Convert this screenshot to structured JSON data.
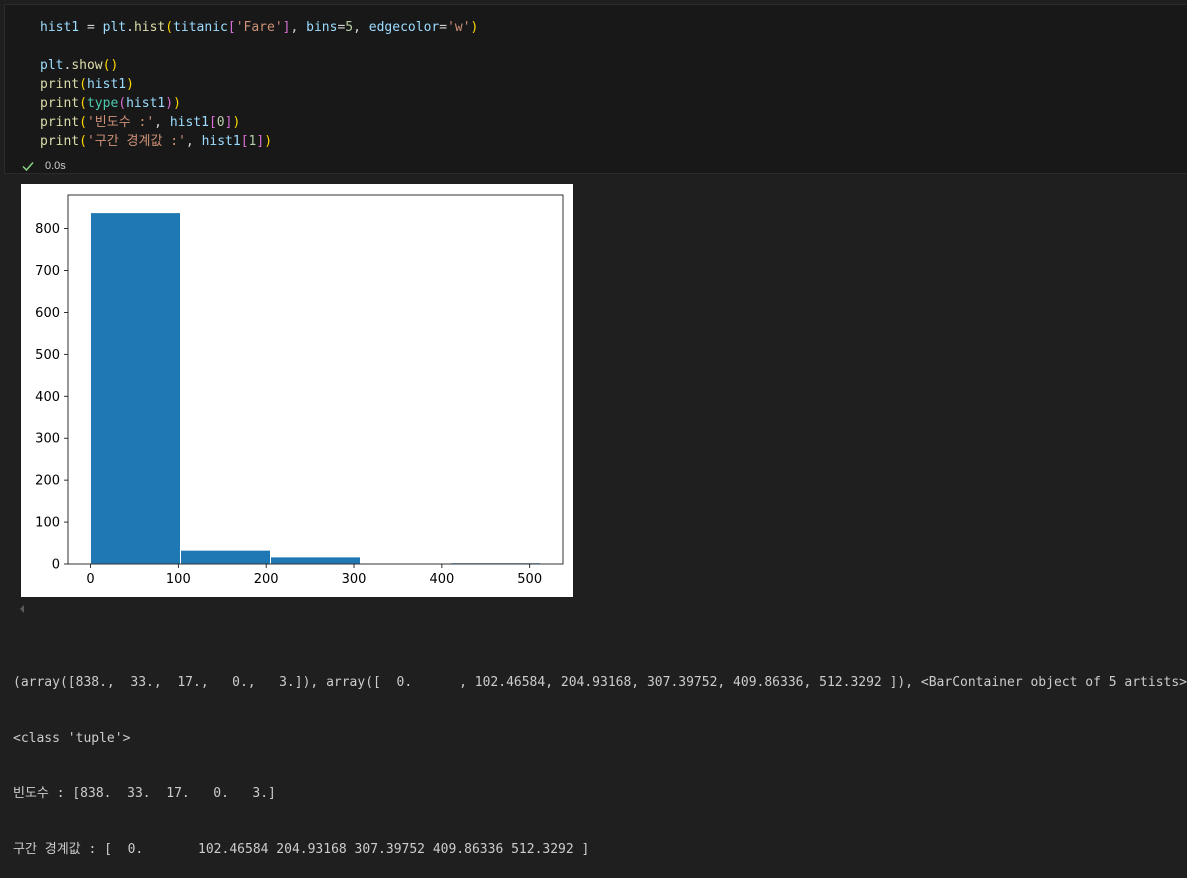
{
  "code_cell": {
    "lines": [
      [
        {
          "t": "hist1",
          "c": "tk-var"
        },
        {
          "t": " = ",
          "c": "tk-op"
        },
        {
          "t": "plt",
          "c": "tk-var"
        },
        {
          "t": ".",
          "c": "tk-op"
        },
        {
          "t": "hist",
          "c": "tk-fn"
        },
        {
          "t": "(",
          "c": "tk-b1"
        },
        {
          "t": "titanic",
          "c": "tk-var"
        },
        {
          "t": "[",
          "c": "tk-b2"
        },
        {
          "t": "'Fare'",
          "c": "tk-str"
        },
        {
          "t": "]",
          "c": "tk-b2"
        },
        {
          "t": ", ",
          "c": "tk-op"
        },
        {
          "t": "bins",
          "c": "tk-var"
        },
        {
          "t": "=",
          "c": "tk-op"
        },
        {
          "t": "5",
          "c": "tk-num"
        },
        {
          "t": ", ",
          "c": "tk-op"
        },
        {
          "t": "edgecolor",
          "c": "tk-var"
        },
        {
          "t": "=",
          "c": "tk-op"
        },
        {
          "t": "'w'",
          "c": "tk-str"
        },
        {
          "t": ")",
          "c": "tk-b1"
        }
      ],
      [],
      [
        {
          "t": "plt",
          "c": "tk-var"
        },
        {
          "t": ".",
          "c": "tk-op"
        },
        {
          "t": "show",
          "c": "tk-fn"
        },
        {
          "t": "()",
          "c": "tk-b1"
        }
      ],
      [
        {
          "t": "print",
          "c": "tk-fn"
        },
        {
          "t": "(",
          "c": "tk-b1"
        },
        {
          "t": "hist1",
          "c": "tk-var"
        },
        {
          "t": ")",
          "c": "tk-b1"
        }
      ],
      [
        {
          "t": "print",
          "c": "tk-fn"
        },
        {
          "t": "(",
          "c": "tk-b1"
        },
        {
          "t": "type",
          "c": "tk-cls"
        },
        {
          "t": "(",
          "c": "tk-b2"
        },
        {
          "t": "hist1",
          "c": "tk-var"
        },
        {
          "t": ")",
          "c": "tk-b2"
        },
        {
          "t": ")",
          "c": "tk-b1"
        }
      ],
      [
        {
          "t": "print",
          "c": "tk-fn"
        },
        {
          "t": "(",
          "c": "tk-b1"
        },
        {
          "t": "'빈도수 :'",
          "c": "tk-str"
        },
        {
          "t": ", ",
          "c": "tk-op"
        },
        {
          "t": "hist1",
          "c": "tk-var"
        },
        {
          "t": "[",
          "c": "tk-b2"
        },
        {
          "t": "0",
          "c": "tk-num"
        },
        {
          "t": "]",
          "c": "tk-b2"
        },
        {
          "t": ")",
          "c": "tk-b1"
        }
      ],
      [
        {
          "t": "print",
          "c": "tk-fn"
        },
        {
          "t": "(",
          "c": "tk-b1"
        },
        {
          "t": "'구간 경계값 :'",
          "c": "tk-str"
        },
        {
          "t": ", ",
          "c": "tk-op"
        },
        {
          "t": "hist1",
          "c": "tk-var"
        },
        {
          "t": "[",
          "c": "tk-b2"
        },
        {
          "t": "1",
          "c": "tk-num"
        },
        {
          "t": "]",
          "c": "tk-b2"
        },
        {
          "t": ")",
          "c": "tk-b1"
        }
      ]
    ]
  },
  "exec_status": {
    "icon": "check-icon",
    "time": "0.0s",
    "color": "#89d185"
  },
  "chart_data": {
    "type": "bar",
    "subtype": "histogram",
    "bin_edges": [
      0,
      102.46584,
      204.93168,
      307.39752,
      409.86336,
      512.3292
    ],
    "values": [
      838,
      33,
      17,
      0,
      3
    ],
    "xticks": [
      0,
      100,
      200,
      300,
      400,
      500
    ],
    "yticks": [
      0,
      100,
      200,
      300,
      400,
      500,
      600,
      700,
      800
    ],
    "xlim": [
      -25.6,
      537.9
    ],
    "ylim": [
      0,
      880
    ],
    "bar_color": "#1f77b4",
    "edge_color": "#ffffff",
    "title": "",
    "xlabel": "",
    "ylabel": "",
    "grid": false
  },
  "output": {
    "lines": [
      "(array([838.,  33.,  17.,   0.,   3.]), array([  0.      , 102.46584, 204.93168, 307.39752, 409.86336, 512.3292 ]), <BarContainer object of 5 artists>)",
      "<class 'tuple'>",
      "빈도수 : [838.  33.  17.   0.   3.]",
      "구간 경계값 : [  0.       102.46584 204.93168 307.39752 409.86336 512.3292 ]"
    ]
  }
}
